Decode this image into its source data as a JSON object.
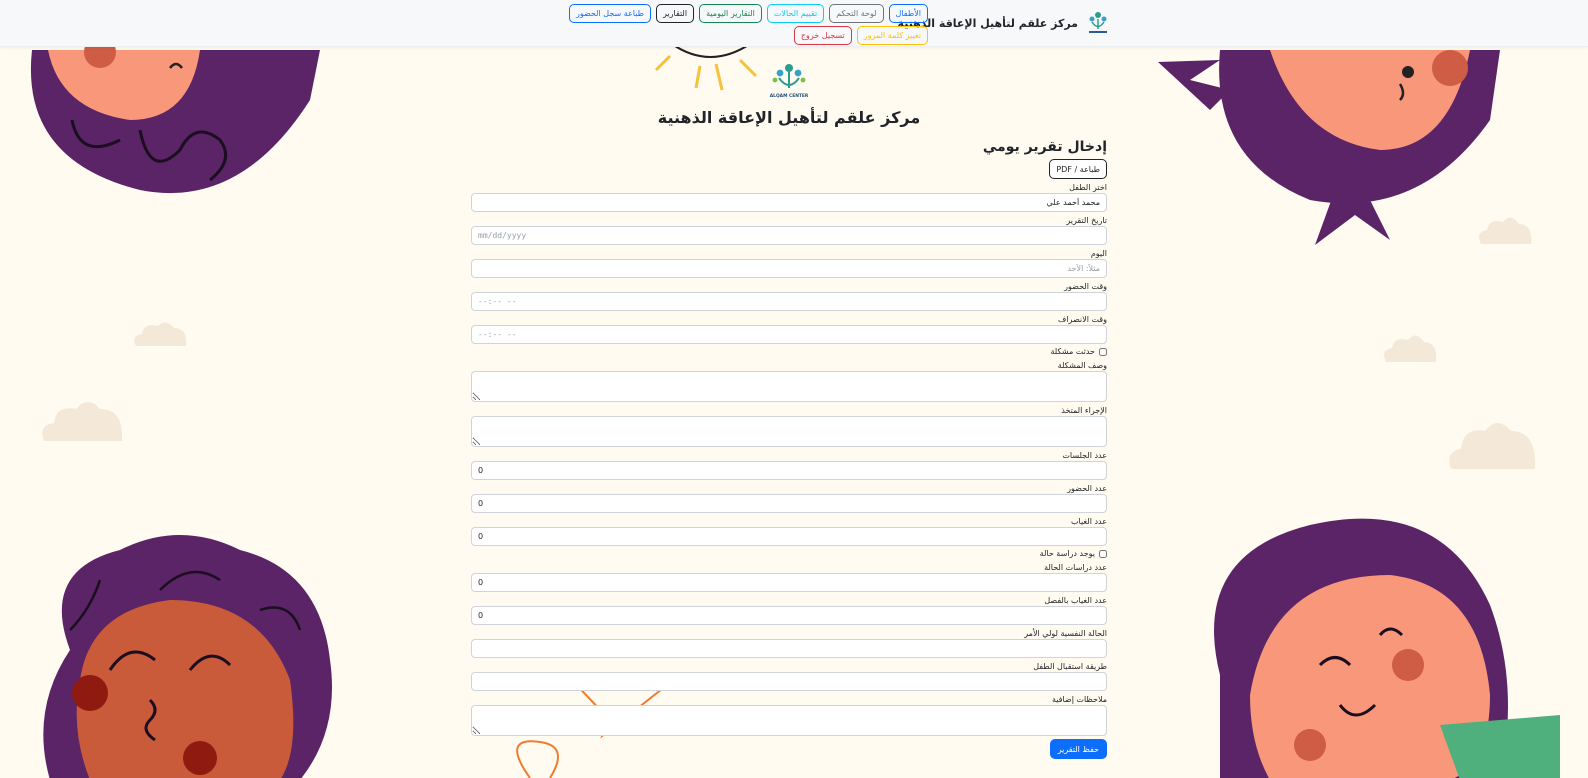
{
  "navbar": {
    "brand": "مركز علقم لتأهيل الإعاقة الذهنية",
    "buttons": [
      {
        "label": "الأطفال",
        "variant": "primary"
      },
      {
        "label": "لوحة التحكم",
        "variant": "secondary"
      },
      {
        "label": "تقييم الحالات",
        "variant": "info"
      },
      {
        "label": "التقارير اليومية",
        "variant": "success"
      },
      {
        "label": "التقارير",
        "variant": "dark"
      },
      {
        "label": "طباعة سجل الحضور",
        "variant": "primary"
      },
      {
        "label": "تغيير كلمة المرور",
        "variant": "warning"
      },
      {
        "label": "تسجيل خروج",
        "variant": "danger"
      }
    ]
  },
  "header": {
    "logo_caption": "ALQAM CENTER",
    "title": "مركز علقم لتأهيل الإعاقة الذهنية"
  },
  "form": {
    "heading": "إدخال تقرير يومي",
    "pdf_button": "طباعة / PDF",
    "child_label": "اختر الطفل",
    "child_value": "محمد أحمد علي",
    "date_label": "تاريخ التقرير",
    "date_placeholder": "mm/dd/yyyy",
    "day_label": "اليوم",
    "day_placeholder": "مثلاً: الأحد",
    "arrival_label": "وقت الحضور",
    "arrival_placeholder": "--:-- --",
    "leave_label": "وقت الانصراف",
    "leave_placeholder": "--:-- --",
    "problem_checkbox": "حدثت مشكلة",
    "problem_desc_label": "وصف المشكلة",
    "action_label": "الإجراء المتخذ",
    "sessions_label": "عدد الجلسات",
    "sessions_value": "0",
    "attendance_label": "عدد الحضور",
    "attendance_value": "0",
    "absence_label": "عدد الغياب",
    "absence_value": "0",
    "case_study_checkbox": "يوجد دراسة حالة",
    "case_studies_label": "عدد دراسات الحالة",
    "case_studies_value": "0",
    "class_absence_label": "عدد الغياب بالفصل",
    "class_absence_value": "0",
    "guardian_state_label": "الحالة النفسية لولي الأمر",
    "reception_label": "طريقة استقبال الطفل",
    "notes_label": "ملاحظات إضافية",
    "save_button": "حفظ التقرير"
  },
  "colors": {
    "page_bg": "#fffbf1",
    "hair_purple": "#5a2466",
    "skin": "#f9977b",
    "skin_dark": "#c95a3a",
    "cheek": "#cf5c45",
    "shirt_green": "#4fb07e",
    "sun": "#f5c33b",
    "doodle_orange": "#f07b2e",
    "cloud": "#f4e9d8",
    "primary": "#0d6efd"
  }
}
